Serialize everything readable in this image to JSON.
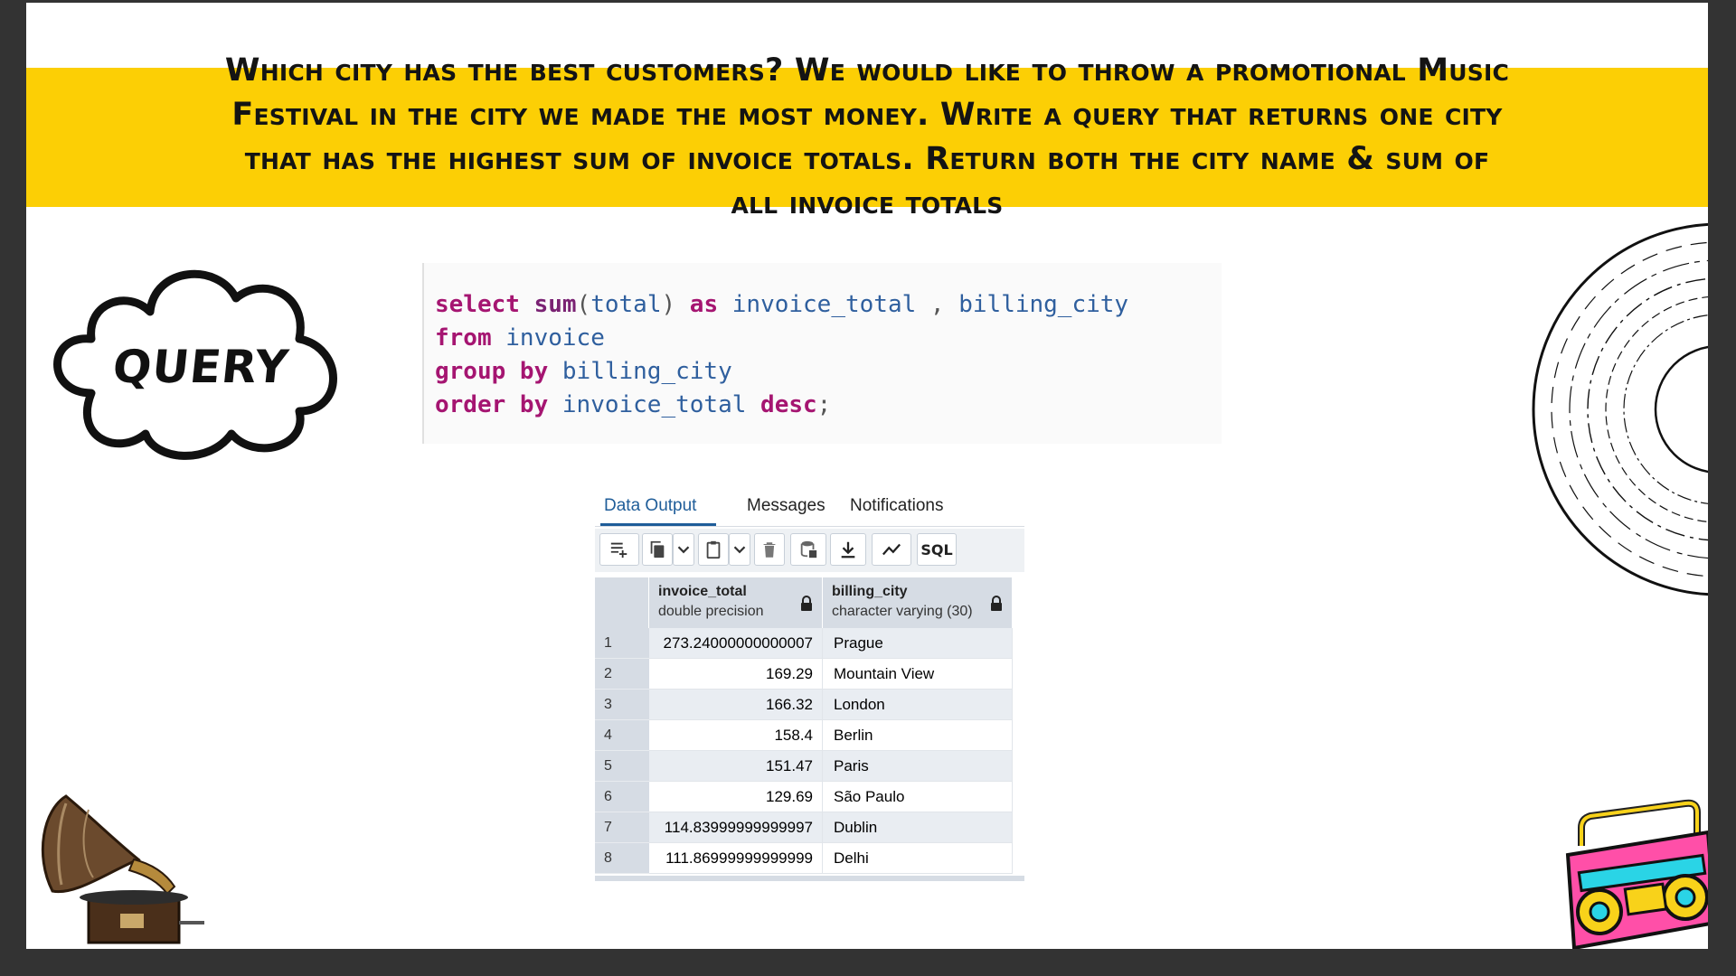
{
  "banner": {
    "text": "Which city has the best customers? We would like to throw a promotional Music Festival in the city we made the most money. Write a query that returns one city that has the highest sum of invoice totals. Return both the city name & sum of all invoice totals"
  },
  "cloud_label": "QUERY",
  "code": {
    "line1": {
      "k1": "select",
      "f1": "sum",
      "p1": "(",
      "i1": "total",
      "p2": ")",
      "k2": "as",
      "i2": "invoice_total",
      "p3": ",",
      "i3": "billing_city"
    },
    "line2": {
      "k1": "from",
      "i1": "invoice"
    },
    "line3": {
      "k1": "group by",
      "i1": "billing_city"
    },
    "line4": {
      "k1": "order by",
      "i1": "invoice_total",
      "k2": "desc",
      "p1": ";"
    }
  },
  "panel": {
    "tabs": [
      "Data Output",
      "Messages",
      "Notifications"
    ],
    "active_tab": "Data Output",
    "toolbar": {
      "sql_label": "SQL"
    },
    "columns": [
      {
        "name": "invoice_total",
        "type": "double precision"
      },
      {
        "name": "billing_city",
        "type": "character varying (30)"
      }
    ],
    "rows": [
      {
        "n": "1",
        "invoice_total": "273.24000000000007",
        "billing_city": "Prague"
      },
      {
        "n": "2",
        "invoice_total": "169.29",
        "billing_city": "Mountain View"
      },
      {
        "n": "3",
        "invoice_total": "166.32",
        "billing_city": "London"
      },
      {
        "n": "4",
        "invoice_total": "158.4",
        "billing_city": "Berlin"
      },
      {
        "n": "5",
        "invoice_total": "151.47",
        "billing_city": "Paris"
      },
      {
        "n": "6",
        "invoice_total": "129.69",
        "billing_city": "São Paulo"
      },
      {
        "n": "7",
        "invoice_total": "114.83999999999997",
        "billing_city": "Dublin"
      },
      {
        "n": "8",
        "invoice_total": "111.86999999999999",
        "billing_city": "Delhi"
      }
    ]
  },
  "colors": {
    "banner": "#fccf05",
    "keyword": "#a51571",
    "identifier": "#2f5f9e",
    "tab_active": "#1f5d99",
    "page_frame": "#333333"
  }
}
